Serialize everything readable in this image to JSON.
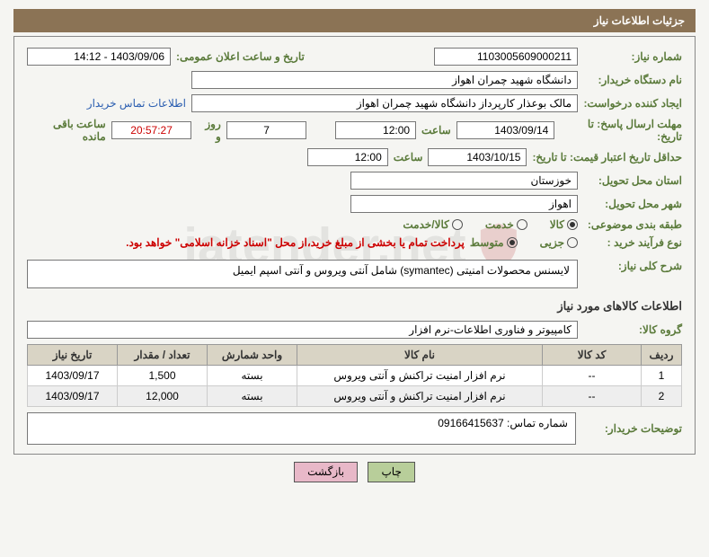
{
  "header": {
    "title": "جزئیات اطلاعات نیاز"
  },
  "labels": {
    "need_no": "شماره نیاز:",
    "announce_dt": "تاریخ و ساعت اعلان عمومی:",
    "buyer_org": "نام دستگاه خریدار:",
    "requester": "ایجاد کننده درخواست:",
    "contact_link": "اطلاعات تماس خریدار",
    "deadline": "مهلت ارسال پاسخ: تا تاریخ:",
    "time": "ساعت",
    "days_and": "روز و",
    "remaining": "ساعت باقی مانده",
    "price_validity": "حداقل تاریخ اعتبار قیمت: تا تاریخ:",
    "delivery_province": "استان محل تحویل:",
    "delivery_city": "شهر محل تحویل:",
    "category": "طبقه بندی موضوعی:",
    "purchase_type": "نوع فرآیند خرید :",
    "general_desc": "شرح کلی نیاز:",
    "goods_info": "اطلاعات کالاهای مورد نیاز",
    "goods_group": "گروه کالا:",
    "buyer_notes": "توضیحات خریدار:"
  },
  "fields": {
    "need_no": "1103005609000211",
    "announce_dt": "1403/09/06 - 14:12",
    "buyer_org": "دانشگاه شهید چمران اهواز",
    "requester": "مالک بوعذار کارپرداز دانشگاه شهید چمران اهواز",
    "deadline_date": "1403/09/14",
    "deadline_time": "12:00",
    "days_left": "7",
    "countdown": "20:57:27",
    "price_validity_date": "1403/10/15",
    "price_validity_time": "12:00",
    "province": "خوزستان",
    "city": "اهواز",
    "general_desc": "لایسنس محصولات امنیتی (symantec) شامل آنتی ویروس و آنتی اسپم ایمیل",
    "goods_group": "کامپیوتر و فناوری اطلاعات-نرم افزار",
    "buyer_notes": "شماره تماس: 09166415637"
  },
  "radios": {
    "category": [
      {
        "label": "کالا",
        "checked": true
      },
      {
        "label": "خدمت",
        "checked": false
      },
      {
        "label": "کالا/خدمت",
        "checked": false
      }
    ],
    "purchase": [
      {
        "label": "جزیی",
        "checked": false
      },
      {
        "label": "متوسط",
        "checked": true
      }
    ]
  },
  "purchase_note": "پرداخت تمام یا بخشی از مبلغ خرید،از محل \"اسناد خزانه اسلامی\" خواهد بود.",
  "table": {
    "headers": [
      "ردیف",
      "کد کالا",
      "نام کالا",
      "واحد شمارش",
      "تعداد / مقدار",
      "تاریخ نیاز"
    ],
    "rows": [
      {
        "idx": "1",
        "code": "--",
        "name": "نرم افزار امنیت تراکنش و آنتی ویروس",
        "unit": "بسته",
        "qty": "1,500",
        "date": "1403/09/17"
      },
      {
        "idx": "2",
        "code": "--",
        "name": "نرم افزار امنیت تراکنش و آنتی ویروس",
        "unit": "بسته",
        "qty": "12,000",
        "date": "1403/09/17"
      }
    ]
  },
  "buttons": {
    "print": "چاپ",
    "back": "بازگشت"
  },
  "watermark": "iatender.net"
}
